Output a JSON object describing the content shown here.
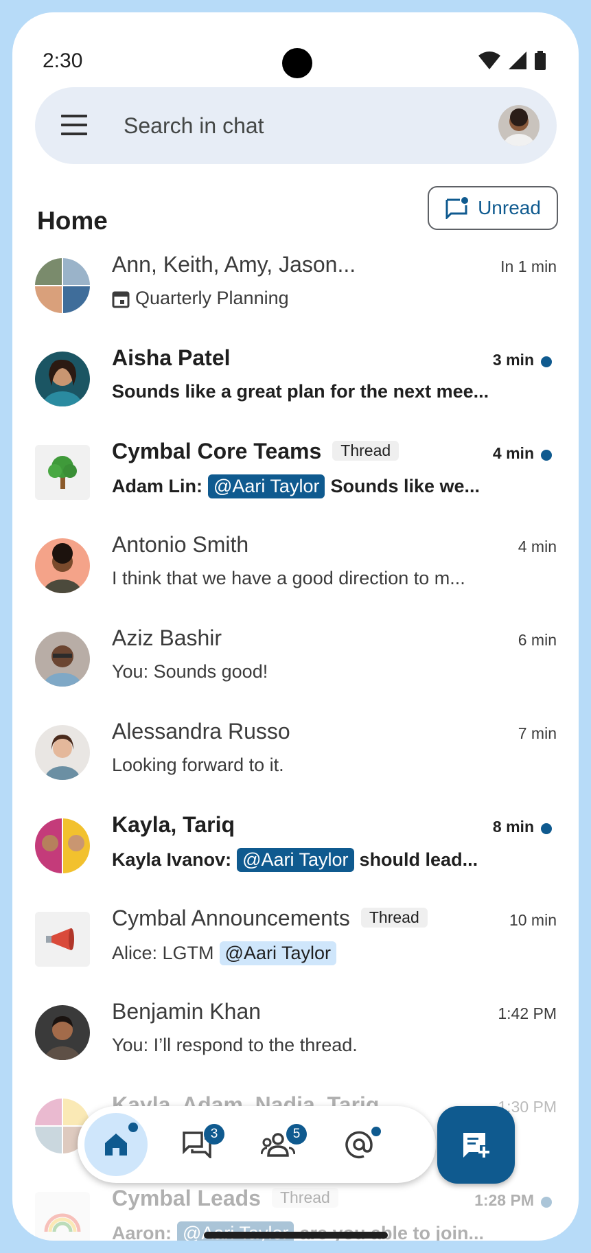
{
  "status_bar": {
    "time": "2:30"
  },
  "search": {
    "placeholder": "Search in chat"
  },
  "header": {
    "title": "Home",
    "unread_label": "Unread"
  },
  "accent_color": "#0f5a8f",
  "chats": [
    {
      "title": "Ann, Keith, Amy, Jason...",
      "time": "In 1 min",
      "subtitle": "Quarterly Planning",
      "subtitle_icon": "calendar-icon",
      "unread": false,
      "avatar": "group-avatar"
    },
    {
      "title": "Aisha Patel",
      "time": "3 min",
      "subtitle": "Sounds like a great plan for the next mee...",
      "unread": true,
      "avatar": "person-avatar"
    },
    {
      "title": "Cymbal Core Teams",
      "chip": "Thread",
      "time": "4 min",
      "subtitle_prefix": "Adam Lin:",
      "mention": "@Aari Taylor",
      "subtitle_suffix": "Sounds like we...",
      "unread": true,
      "avatar": "tree-icon"
    },
    {
      "title": "Antonio Smith",
      "time": "4 min",
      "subtitle": "I think that we have a good direction to m...",
      "unread": false,
      "avatar": "person-avatar"
    },
    {
      "title": "Aziz Bashir",
      "time": "6 min",
      "subtitle": "You: Sounds good!",
      "unread": false,
      "avatar": "person-avatar"
    },
    {
      "title": "Alessandra Russo",
      "time": "7 min",
      "subtitle": "Looking forward to it.",
      "unread": false,
      "avatar": "person-avatar"
    },
    {
      "title": "Kayla, Tariq",
      "time": "8 min",
      "subtitle_prefix": "Kayla Ivanov:",
      "mention": "@Aari Taylor",
      "subtitle_suffix": "should lead...",
      "unread": true,
      "avatar": "pair-avatar"
    },
    {
      "title": "Cymbal Announcements",
      "chip": "Thread",
      "time": "10 min",
      "subtitle_prefix": "Alice: LGTM",
      "mention": "@Aari Taylor",
      "subtitle_suffix": "",
      "unread": false,
      "avatar": "megaphone-icon"
    },
    {
      "title": "Benjamin Khan",
      "time": "1:42 PM",
      "subtitle": "You: I’ll respond to the thread.",
      "unread": false,
      "avatar": "person-avatar"
    },
    {
      "title": "Kayla, Adam, Nadia, Tariq",
      "time": "1:30 PM",
      "subtitle": "",
      "unread": false,
      "avatar": "group-avatar"
    },
    {
      "title": "Cymbal Leads",
      "chip": "Thread",
      "time": "1:28 PM",
      "subtitle_prefix": "Aaron:",
      "mention": "@Aari Taylor",
      "subtitle_suffix": "are you able to join...",
      "unread": true,
      "avatar": "rainbow-icon"
    }
  ],
  "nav": {
    "home": "home-icon",
    "chats_badge": "3",
    "spaces_badge": "5",
    "mentions": "at-icon"
  },
  "fab": {
    "icon": "new-chat-icon"
  }
}
